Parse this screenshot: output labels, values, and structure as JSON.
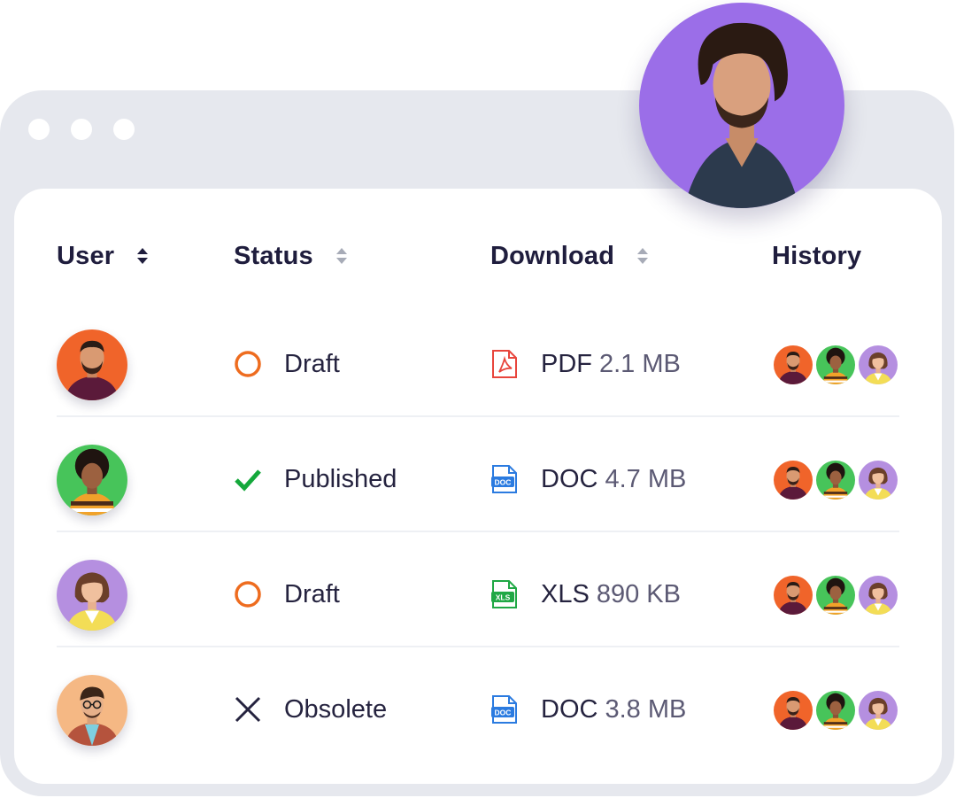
{
  "table": {
    "columns": [
      {
        "label": "User",
        "sortable": true
      },
      {
        "label": "Status",
        "sortable": true
      },
      {
        "label": "Download",
        "sortable": true
      },
      {
        "label": "History",
        "sortable": false
      }
    ],
    "rows": [
      {
        "user_avatar": {
          "bg": "#f0642a",
          "person": "man-beard"
        },
        "status": {
          "label": "Draft",
          "icon": "circle-outline-icon",
          "color": "#ee6c1f"
        },
        "download": {
          "type": "PDF",
          "size": "2.1 MB",
          "icon": "pdf-file-icon",
          "color": "#e8453c"
        },
        "history": [
          "man-beard",
          "woman-curly",
          "woman-bob"
        ]
      },
      {
        "user_avatar": {
          "bg": "#47c45a",
          "person": "woman-curly"
        },
        "status": {
          "label": "Published",
          "icon": "checkmark-icon",
          "color": "#14a83b"
        },
        "download": {
          "type": "DOC",
          "size": "4.7 MB",
          "icon": "doc-file-icon",
          "color": "#2b7be0"
        },
        "history": [
          "man-beard",
          "woman-curly",
          "woman-bob"
        ]
      },
      {
        "user_avatar": {
          "bg": "#b58fe0",
          "person": "woman-bob"
        },
        "status": {
          "label": "Draft",
          "icon": "circle-outline-icon",
          "color": "#ee6c1f"
        },
        "download": {
          "type": "XLS",
          "size": "890 KB",
          "icon": "xls-file-icon",
          "color": "#20a845"
        },
        "history": [
          "man-beard",
          "woman-curly",
          "woman-bob"
        ]
      },
      {
        "user_avatar": {
          "bg": "#f5b884",
          "person": "man-glasses"
        },
        "status": {
          "label": "Obsolete",
          "icon": "x-mark-icon",
          "color": "#25233f"
        },
        "download": {
          "type": "DOC",
          "size": "3.8 MB",
          "icon": "doc-file-icon",
          "color": "#2b7be0"
        },
        "history": [
          "man-beard",
          "woman-curly",
          "woman-bob"
        ]
      }
    ]
  },
  "hero_avatar": {
    "bg": "#9b6ee8",
    "person": "man-curly-hair"
  },
  "colors": {
    "frame": "#e6e8ee",
    "text": "#1f1d3d",
    "muted": "#5c5a74",
    "sort_icon": "#a7abb7"
  }
}
